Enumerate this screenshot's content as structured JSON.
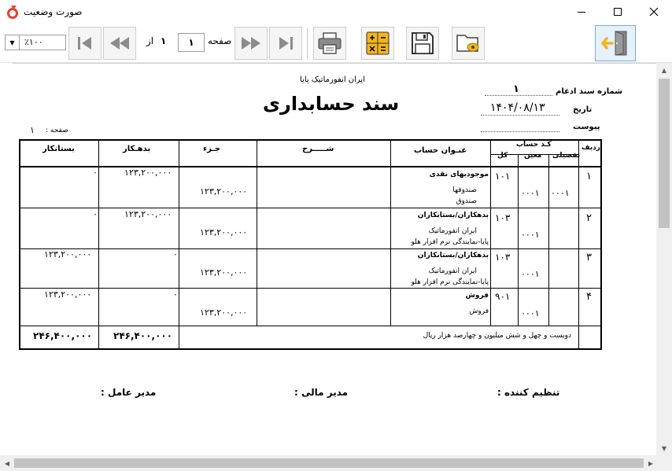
{
  "window": {
    "title": "صورت وضعیت",
    "logo_icon": "app-logo-icon",
    "brand_color": "#e8412c"
  },
  "toolbar": {
    "zoom": "٪۱۰۰",
    "page_label": "صفحه",
    "current_page": "۱",
    "of_label": "از",
    "total_pages": "۱",
    "accent_color": "#f2b51c"
  },
  "document": {
    "company_name": "ایران انفورماتیک پایا",
    "title": "سند حسابداری",
    "page_no_label": "صفحه :",
    "page_no": "۱",
    "merge_no_label": "شماره سند ادغام",
    "merge_no": "۱",
    "date_label": "تاریخ",
    "date": "۱۴۰۴/۰۸/۱۳",
    "attachment_label": "پیوست",
    "headers": {
      "row": "ردیف",
      "account_code": "کـد حساب",
      "detail": "تفصیلی",
      "moein": "معین",
      "kol": "کل",
      "account_title": "عنـوان حساب",
      "description": "شـــــرح",
      "partial": "جـزء",
      "debit": "بدهـکار",
      "credit": "بستانکار"
    },
    "rows": [
      {
        "row": "۱",
        "kol": "۱۰۱",
        "moein": "۰۰۰۱",
        "detail": "۰۰۰۱",
        "title": "موجودیهای نقدی",
        "sub1": "صندوقها",
        "sub2": "صندوق",
        "partial": "۱۲۳,۲۰۰,۰۰۰",
        "debit": "۱۲۳,۲۰۰,۰۰۰",
        "credit": "۰"
      },
      {
        "row": "۲",
        "kol": "۱۰۳",
        "moein": "۰۰۰۱",
        "detail": "",
        "title": "بدهکاران/بستانکاران",
        "sub1": "ایران انفورماتیک",
        "sub2": "پایا-نمایندگی نرم افزار هلو",
        "partial": "۱۲۳,۲۰۰,۰۰۰",
        "debit": "۱۲۳,۲۰۰,۰۰۰",
        "credit": "۰"
      },
      {
        "row": "۳",
        "kol": "۱۰۳",
        "moein": "۰۰۰۱",
        "detail": "",
        "title": "بدهکاران/بستانکاران",
        "sub1": "ایران انفورماتیک",
        "sub2": "پایا-نمایندگی نرم افزار هلو",
        "partial": "۱۲۳,۲۰۰,۰۰۰",
        "debit": "۰",
        "credit": "۱۲۳,۲۰۰,۰۰۰"
      },
      {
        "row": "۴",
        "kol": "۹۰۱",
        "moein": "۰۰۰۱",
        "detail": "",
        "title": "فروش",
        "sub1": "فروش",
        "sub2": "",
        "partial": "۱۲۳,۲۰۰,۰۰۰",
        "debit": "۰",
        "credit": "۱۲۳,۲۰۰,۰۰۰"
      }
    ],
    "total_words": "دویست و چهل و شش میلیون  و چهارصد هزار  ریال",
    "total_debit": "۲۴۶,۴۰۰,۰۰۰",
    "total_credit": "۲۴۶,۴۰۰,۰۰۰",
    "signatures": {
      "preparer": "تنظیم کننده :",
      "finance_manager": "مدیر مالی :",
      "ceo": "مدیر عامل :"
    }
  }
}
